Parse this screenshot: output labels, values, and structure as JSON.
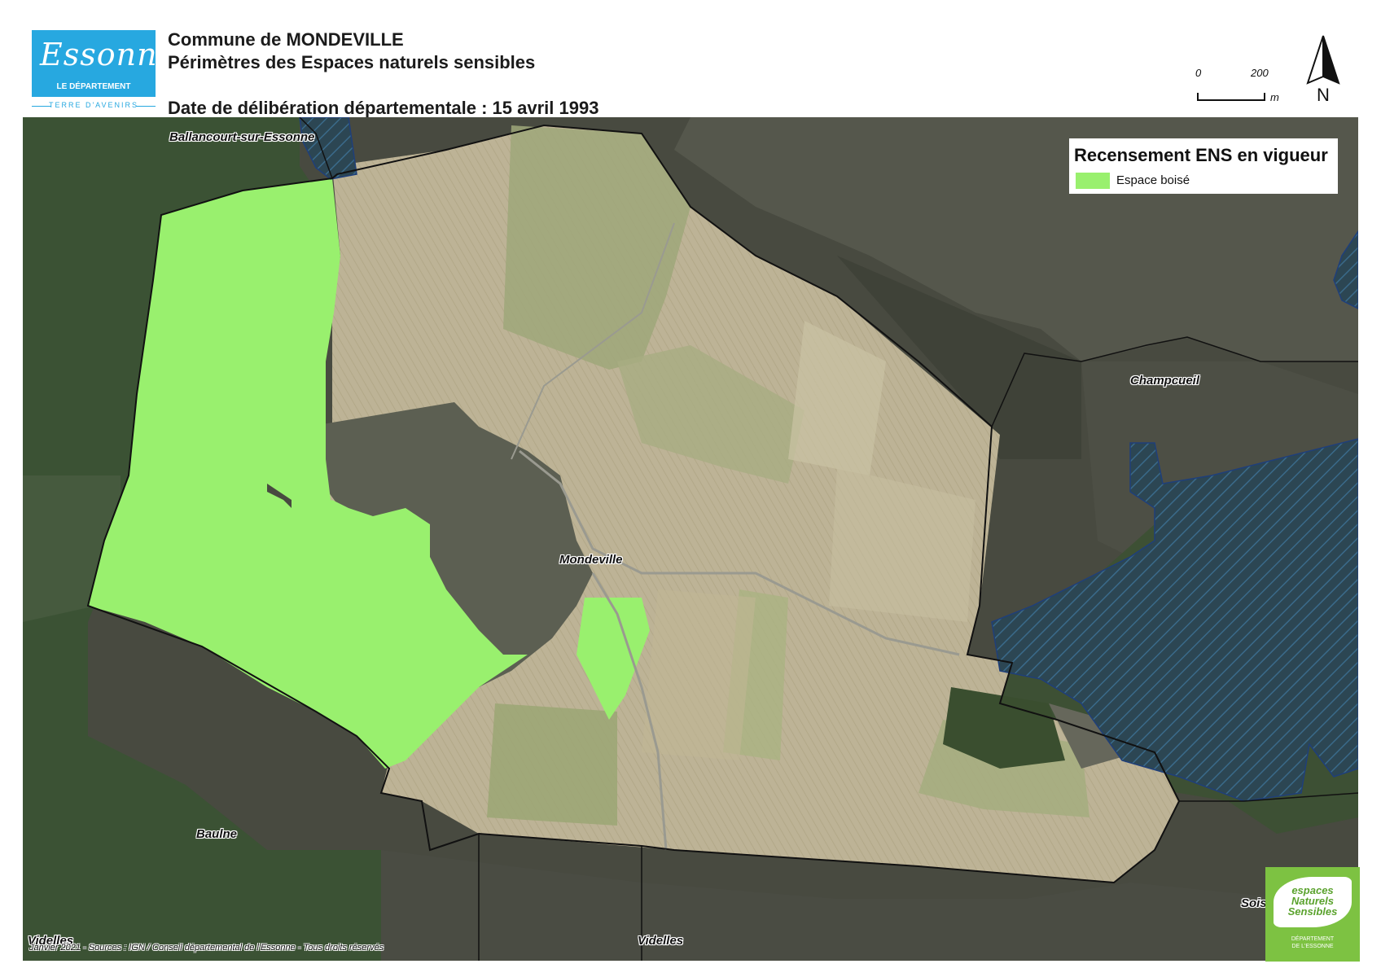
{
  "header": {
    "logo_script": "Essonne",
    "logo_subtitle": "LE DÉPARTEMENT",
    "logo_tagline": "TERRE D'AVENIRS",
    "title_line1": "Commune de MONDEVILLE",
    "title_line2": "Périmètres des Espaces naturels sensibles",
    "title_line3": "Date de délibération départementale : 15 avril 1993"
  },
  "scale_bar": {
    "start": "0",
    "end": "200",
    "unit": "m"
  },
  "north_arrow": {
    "label": "N",
    "icon": "north-arrow-icon"
  },
  "legend": {
    "title": "Recensement ENS en vigueur",
    "items": [
      {
        "label": "Espace boisé",
        "color": "#99f06e"
      }
    ]
  },
  "map": {
    "places": {
      "ballancourt": "Ballancourt-sur-Essonne",
      "champcueil": "Champcueil",
      "mondeville": "Mondeville",
      "baulne": "Baulne",
      "videlles": "Videlles",
      "videlles_edge": "Videlles",
      "soisy_edge": "Sois"
    },
    "colors": {
      "outside_commune": "#4a4d42",
      "woodland_outside": "#3c5534",
      "fields": "#b9b093",
      "espace_boise": "#99f06e",
      "hatched_ens": "#2e4a5c",
      "commune_border": "#111111"
    },
    "credits": "Janvier 2021 - Sources : IGN / Conseil départemental de l'Essonne - Tous droits réservés"
  },
  "ens_logo": {
    "line1": "espaces",
    "line2": "Naturels",
    "line3": "Sensibles",
    "sub1": "DÉPARTEMENT",
    "sub2": "DE L'ESSONNE"
  }
}
